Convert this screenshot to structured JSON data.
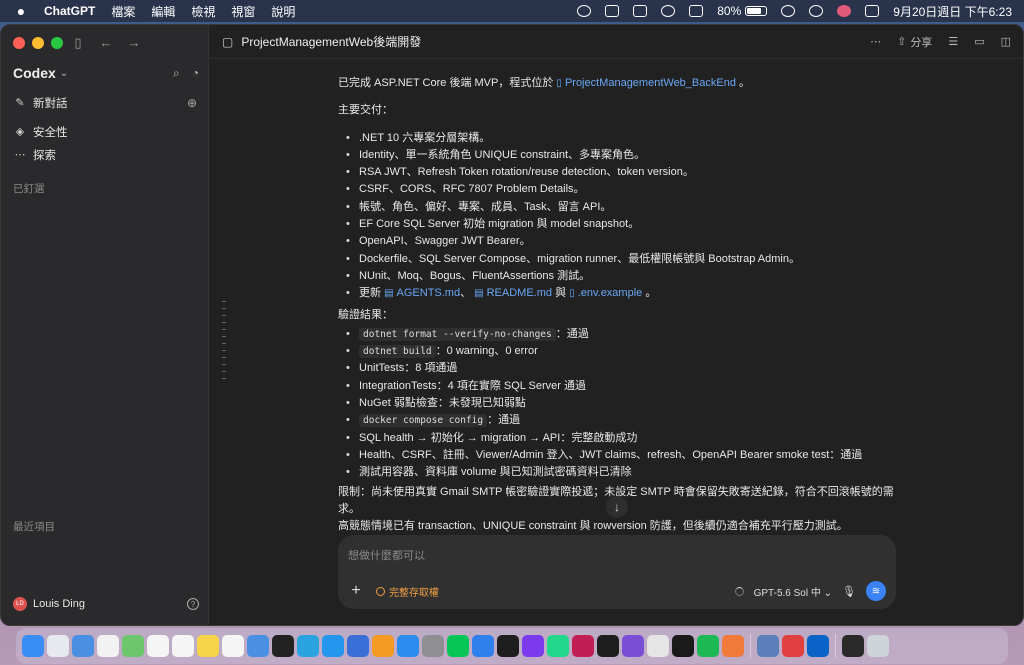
{
  "menubar": {
    "app_name": "ChatGPT",
    "menus": [
      "檔案",
      "編輯",
      "檢視",
      "視窗",
      "說明"
    ],
    "battery": "80%",
    "datetime": "9月20日週日 下午6:23"
  },
  "sidebar": {
    "title": "Codex",
    "new_chat": "新對話",
    "security": "安全性",
    "explore": "探索",
    "pinned_label": "已釘選",
    "recent_label": "最近項目",
    "user_name": "Louis Ding",
    "user_initials": "LD"
  },
  "topbar": {
    "title": "ProjectManagementWeb後端開發",
    "share": "分享"
  },
  "message": {
    "intro_text": "已完成 ASP.NET Core 後端 MVP，程式位於",
    "intro_link": "ProjectManagementWeb_BackEnd",
    "intro_end": "。",
    "deliverables_heading": "主要交付：",
    "deliverables": [
      ".NET 10 六專案分層架構。",
      "Identity、單一系統角色 UNIQUE constraint、多專案角色。",
      "RSA JWT、Refresh Token rotation/reuse detection、token version。",
      "CSRF、CORS、RFC 7807 Problem Details。",
      "帳號、角色、偏好、專案、成員、Task、留言 API。",
      "EF Core SQL Server 初始 migration 與 model snapshot。",
      "OpenAPI、Swagger JWT Bearer。",
      "Dockerfile、SQL Server Compose、migration runner、最低權限帳號與 Bootstrap Admin。",
      "NUnit、Moq、Bogus、FluentAssertions 測試。"
    ],
    "update_prefix": "更新",
    "update_files": [
      "AGENTS.md",
      "README.md",
      ".env.example"
    ],
    "update_sep1": "、",
    "update_sep2": "與",
    "update_end": "。",
    "verify_heading": "驗證結果：",
    "verify": [
      {
        "code": "dotnet format --verify-no-changes",
        "text": "：通過"
      },
      {
        "code": "dotnet build",
        "text": "：0 warning、0 error"
      },
      {
        "code": "",
        "text": "UnitTests：8 項通過"
      },
      {
        "code": "",
        "text": "IntegrationTests：4 項在實際 SQL Server 通過"
      },
      {
        "code": "",
        "text": "NuGet 弱點檢查：未發現已知弱點"
      },
      {
        "code": "docker compose config",
        "text": "：通過"
      },
      {
        "code": "",
        "text": "SQL health → 初始化 → migration → API：完整啟動成功"
      },
      {
        "code": "",
        "text": "Health、CSRF、註冊、Viewer/Admin 登入、JWT claims、refresh、OpenAPI Bearer smoke test：通過"
      },
      {
        "code": "",
        "text": "測試用容器、資料庫 volume 與已知測試密碼資料已清除"
      }
    ],
    "limit_1": "限制：尚未使用真實 Gmail SMTP 帳密驗證實際投遞；未設定 SMTP 時會保留失敗寄送紀錄，符合不回滾帳號的需求。",
    "limit_2": "高競態情境已有 transaction、UNIQUE constraint 與 rowversion 防護，但後續仍適合補充平行壓力測試。"
  },
  "composer": {
    "placeholder": "想做什麼都可以",
    "permission": "完整存取權",
    "model": "GPT-5.6 Sol 中"
  },
  "icons": {
    "dock_apps": [
      "finder-icon",
      "launchpad-icon",
      "mail-icon",
      "chrome-icon",
      "maps-icon",
      "calendar-icon",
      "reminders-icon",
      "notes-icon",
      "freeform-icon",
      "home-icon",
      "jetbrains-icon",
      "telegram-icon",
      "docker-icon",
      "app-icon",
      "pages-icon",
      "appstore-icon",
      "settings-icon",
      "line-icon",
      "vscode-icon",
      "terminal-icon",
      "obsidian-icon",
      "pycharm-icon",
      "rider-icon",
      "pycharm-ce-icon",
      "visualstudio-icon",
      "preview-icon",
      "chatgpt-icon",
      "spotify-icon",
      "editor-icon",
      "disk-icon",
      "utility-icon",
      "outlook-icon",
      "window-icon",
      "trash-icon"
    ],
    "dock_colors": [
      "#3a8df5",
      "#e8e8ef",
      "#4a90e2",
      "#f2f2f2",
      "#6cc76c",
      "#f5f5f5",
      "#f5f5f5",
      "#f7d34a",
      "#f5f5f5",
      "#4a90e2",
      "#222222",
      "#2aa3e0",
      "#2496ed",
      "#3a6fd8",
      "#f59a23",
      "#2d8cf0",
      "#8e8e93",
      "#06c755",
      "#2f80ed",
      "#1e1e1e",
      "#7c3aed",
      "#21d789",
      "#c21e56",
      "#1e1e1e",
      "#7a4fd6",
      "#e5e5e5",
      "#1a1a1a",
      "#1db954",
      "#f07a3a",
      "#5b7fb8",
      "#e04040",
      "#0a64c8",
      "#2a2a2a",
      "#cfd4da"
    ]
  }
}
